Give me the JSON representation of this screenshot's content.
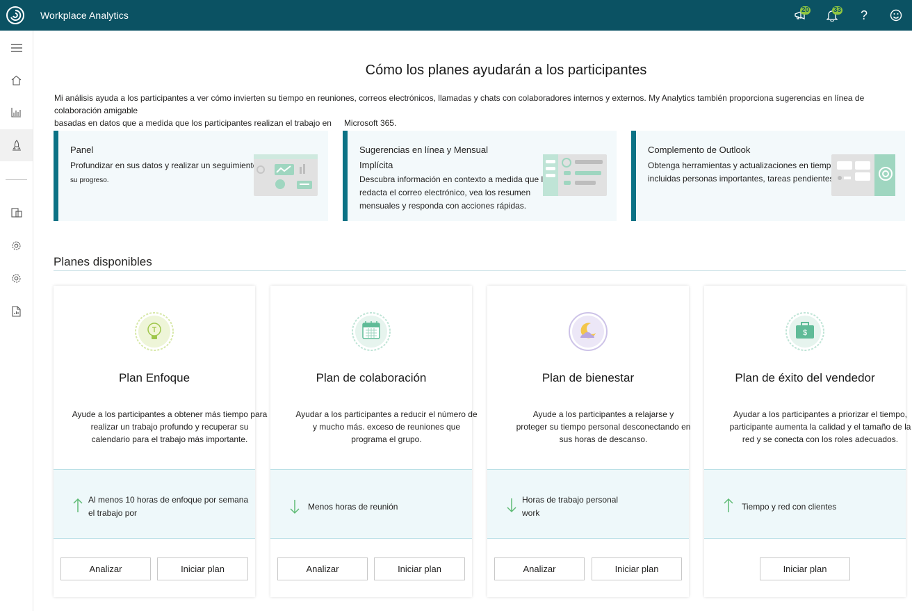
{
  "app": {
    "title": "Workplace Analytics"
  },
  "topbar": {
    "announcements_count": "20",
    "notifications_count": "33",
    "icons": [
      "logo-icon",
      "megaphone-icon",
      "bell-icon",
      "help-icon",
      "smiley-icon"
    ]
  },
  "sidebar": {
    "items": [
      "menu-icon",
      "home-icon",
      "chart-icon",
      "rocket-icon",
      "data-icon",
      "settings-icon",
      "admin-settings-icon",
      "report-icon"
    ]
  },
  "header": {
    "title": "Cómo los planes ayudarán a los participantes",
    "intro_line1": "Mi análisis ayuda a los participantes a ver cómo invierten su tiempo en reuniones, correos electrónicos, llamadas y chats con colaboradores internos y externos. My Analytics también proporciona sugerencias en línea de colaboración amigable",
    "intro_line2": "basadas en datos que a medida que los participantes realizan el trabajo en",
    "intro_tail": "Microsoft 365."
  },
  "features": [
    {
      "title": "Panel",
      "line1": "Profundizar en sus datos y realizar un seguimiento de",
      "line2": "su progreso."
    },
    {
      "title": "Sugerencias en línea y Mensual",
      "title2": "Implícita",
      "line1": "Descubra información en contexto a medida que lee y",
      "line2": "redacta el correo electrónico, vea los resumen",
      "line3": "mensuales y responda con acciones rápidas."
    },
    {
      "title": "Complemento de Outlook",
      "line1": "Obtenga herramientas y actualizaciones en tiempo real,",
      "line2": "incluidas personas importantes, tareas pendientes"
    }
  ],
  "plans_section": {
    "title": "Planes disponibles"
  },
  "plans": [
    {
      "title": "Plan Enfoque",
      "desc1": "Ayude a los participantes a obtener más tiempo para",
      "desc2": "realizar un trabajo profundo y recuperar su",
      "desc3": "calendario para el trabajo más importante.",
      "goal1": "Al menos 10 horas de enfoque por semana",
      "goal2": "el trabajo por",
      "goal_direction": "up",
      "analyze_label": "Analizar",
      "start_label": "Iniciar plan"
    },
    {
      "title": "Plan de colaboración",
      "desc1": "Ayudar a los participantes a reducir el número de",
      "desc2": "y mucho más. exceso de reuniones que",
      "desc3": "programa el grupo.",
      "goal1": "Menos horas de reunión",
      "goal_direction": "down",
      "analyze_label": "Analizar",
      "start_label": "Iniciar plan"
    },
    {
      "title": "Plan de bienestar",
      "desc1": "Ayude a los participantes a relajarse y",
      "desc2": "proteger su tiempo personal desconectando en",
      "desc3": "sus horas de descanso.",
      "goal1": "Horas de trabajo personal",
      "goal2": "work",
      "goal_direction": "down",
      "analyze_label": "Analizar",
      "start_label": "Iniciar plan"
    },
    {
      "title": "Plan de éxito del vendedor",
      "desc1": "Ayudar a los participantes a priorizar el tiempo,",
      "desc2": "participante aumenta la calidad y el tamaño de la",
      "desc3": "red y se conecta con los roles adecuados.",
      "goal1": "Tiempo y red con clientes",
      "goal_direction": "up",
      "start_label": "Iniciar plan"
    }
  ],
  "colors": {
    "topbar": "#0b5263",
    "accent": "#0b7285",
    "badge": "#8fc640",
    "goal_bg": "#eef8fa",
    "arrow": "#5fbb75"
  }
}
